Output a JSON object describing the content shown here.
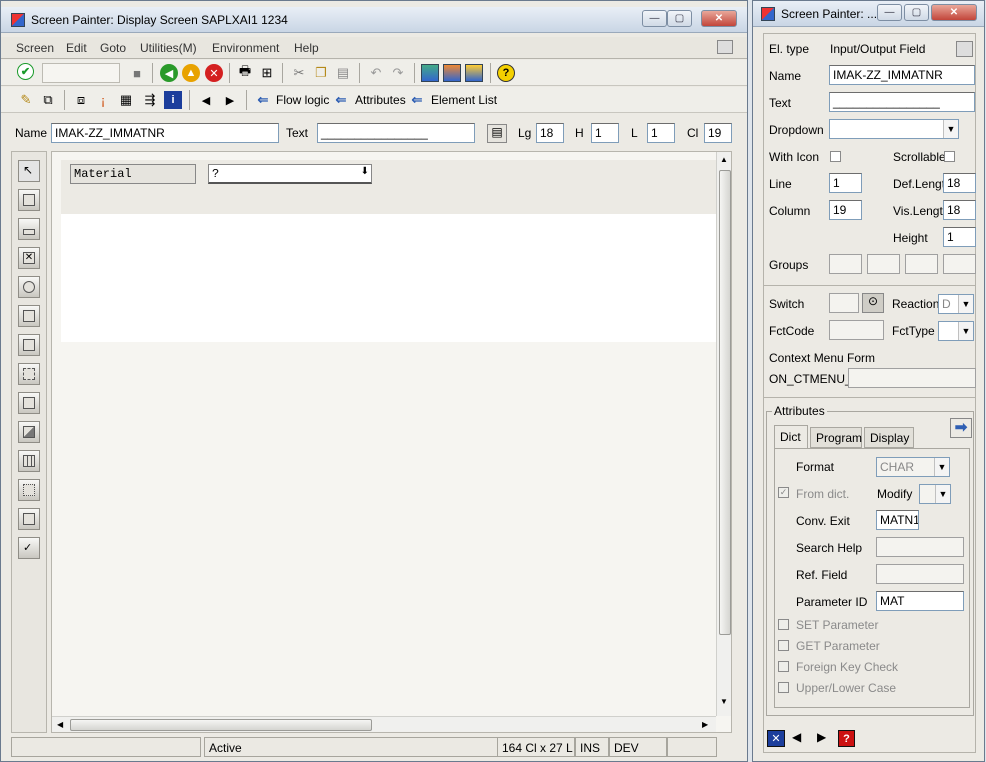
{
  "main": {
    "title": "Screen Painter:  Display Screen SAPLXAI1 1234",
    "menu": [
      "Screen",
      "Edit",
      "Goto",
      "Utilities(M)",
      "Environment",
      "Help"
    ],
    "toolbar2": {
      "flow_logic": "Flow logic",
      "attributes": "Attributes",
      "element_list": "Element List"
    },
    "fieldbar": {
      "name_label": "Name",
      "name_value": "IMAK-ZZ_IMMATNR",
      "text_label": "Text",
      "text_value": "________________",
      "lg_label": "Lg",
      "lg_value": "18",
      "h_label": "H",
      "h_value": "1",
      "l_label": "L",
      "l_value": "1",
      "cl_label": "Cl",
      "cl_value": "19"
    },
    "canvas": {
      "label": "Material",
      "input_value": "?"
    },
    "status": {
      "mode": "Active",
      "size": "164 Cl x 27 L",
      "ins": "INS",
      "sys": "DEV"
    }
  },
  "attr": {
    "title": "Screen Painter: ...",
    "el_type_label": "El. type",
    "el_type_value": "Input/Output Field",
    "name_label": "Name",
    "name_value": "IMAK-ZZ_IMMATNR",
    "text_label": "Text",
    "text_value": "________________",
    "dropdown_label": "Dropdown",
    "with_icon_label": "With Icon",
    "scrollable_label": "Scrollable",
    "line_label": "Line",
    "line_value": "1",
    "def_length_label": "Def.Lengt",
    "def_length_value": "18",
    "column_label": "Column",
    "column_value": "19",
    "vis_length_label": "Vis.Length",
    "vis_length_value": "18",
    "height_label": "Height",
    "height_value": "1",
    "groups_label": "Groups",
    "switch_label": "Switch",
    "reaction_label": "Reaction",
    "reaction_value": "D",
    "fctcode_label": "FctCode",
    "fcttype_label": "FctType",
    "context_label": "Context Menu Form",
    "context_prefix": "ON_CTMENU_",
    "attributes_group": "Attributes",
    "tabs": [
      "Dict",
      "Program",
      "Display"
    ],
    "format_label": "Format",
    "format_value": "CHAR",
    "from_dict_label": "From dict.",
    "modify_label": "Modify",
    "conv_exit_label": "Conv. Exit",
    "conv_exit_value": "MATN1",
    "search_help_label": "Search Help",
    "ref_field_label": "Ref. Field",
    "param_id_label": "Parameter ID",
    "param_id_value": "MAT",
    "checkboxes": [
      "SET Parameter",
      "GET Parameter",
      "Foreign Key Check",
      "Upper/Lower Case"
    ]
  },
  "colors": {
    "accent": "#2f5fb3",
    "checkmark": "#1a9a2a",
    "help": "#cc1111"
  }
}
